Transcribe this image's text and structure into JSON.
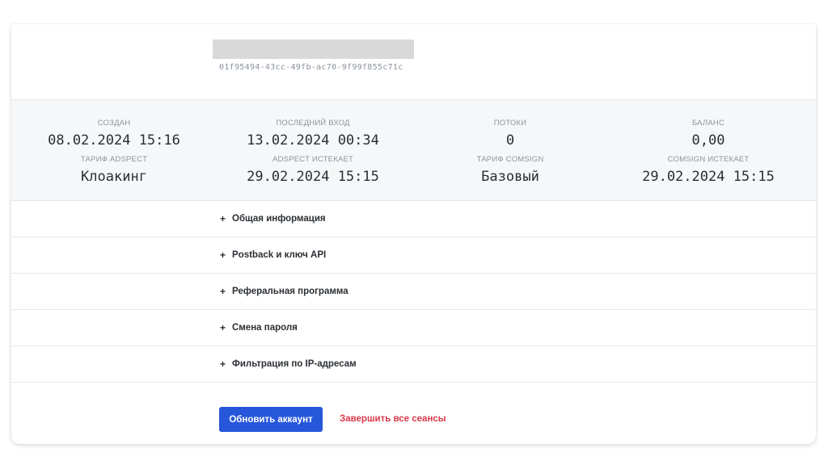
{
  "account": {
    "id": "01f95494-43cc-49fb-ac70-9f99f855c71c"
  },
  "stats": [
    {
      "label": "Создан",
      "value": "08.02.2024 15:16"
    },
    {
      "label": "Последний вход",
      "value": "13.02.2024 00:34"
    },
    {
      "label": "Потоки",
      "value": "0"
    },
    {
      "label": "Баланс",
      "value": "0,00"
    },
    {
      "label": "Тариф Adspect",
      "value": "Клоакинг"
    },
    {
      "label": "Adspect истекает",
      "value": "29.02.2024 15:15"
    },
    {
      "label": "Тариф Comsign",
      "value": "Базовый"
    },
    {
      "label": "Comsign истекает",
      "value": "29.02.2024 15:15"
    }
  ],
  "sections": [
    {
      "icon": "+",
      "title": "Общая информация"
    },
    {
      "icon": "+",
      "title": "Postback и ключ API"
    },
    {
      "icon": "+",
      "title": "Реферальная программа"
    },
    {
      "icon": "+",
      "title": "Смена пароля"
    },
    {
      "icon": "+",
      "title": "Фильтрация по IP-адресам"
    }
  ],
  "actions": {
    "update_label": "Обновить аккаунт",
    "logout_all_label": "Завершить все сеансы"
  },
  "colors": {
    "primary": "#2656d9",
    "danger": "#d9384a",
    "stats_bg": "#f5f7f9"
  }
}
